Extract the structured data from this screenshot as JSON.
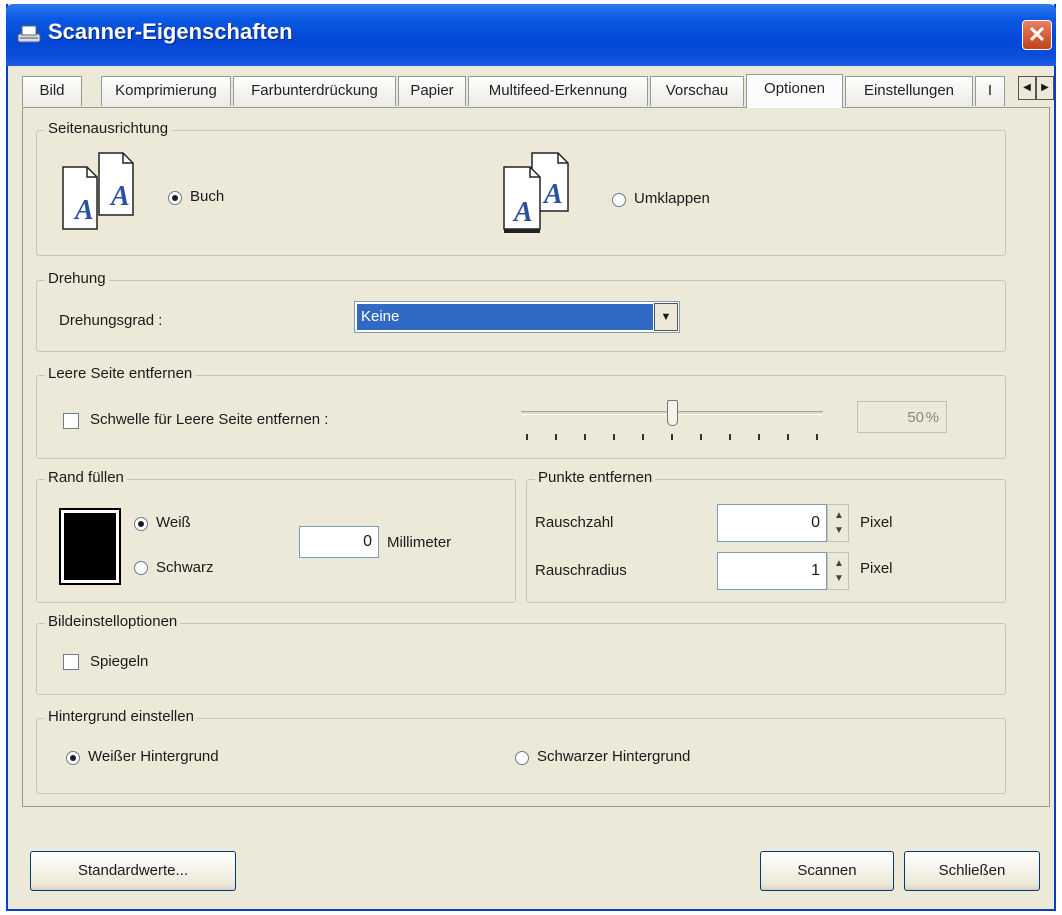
{
  "window": {
    "title": "Scanner-Eigenschaften",
    "close_label": "✕"
  },
  "tabs": [
    {
      "label": "Bild"
    },
    {
      "label": "Komprimierung"
    },
    {
      "label": "Farbunterdrückung"
    },
    {
      "label": "Papier"
    },
    {
      "label": "Multifeed-Erkennung"
    },
    {
      "label": "Vorschau"
    },
    {
      "label": "Optionen",
      "active": true
    },
    {
      "label": "Einstellungen"
    },
    {
      "label": "I"
    }
  ],
  "page_orientation": {
    "legend": "Seitenausrichtung",
    "book": {
      "label": "Buch",
      "checked": true
    },
    "flip": {
      "label": "Umklappen",
      "checked": false
    }
  },
  "rotation": {
    "legend": "Drehung",
    "degree_label": "Drehungsgrad :",
    "selected": "Keine"
  },
  "blank_page": {
    "legend": "Leere Seite entfernen",
    "threshold_label": "Schwelle für Leere Seite entfernen :",
    "threshold_checked": false,
    "slider_value": "50",
    "slider_unit": "%",
    "slider_level": 0.5
  },
  "edge_fill": {
    "legend": "Rand füllen",
    "white_label": "Weiß",
    "black_label": "Schwarz",
    "selected": "white",
    "value": "0",
    "unit": "Millimeter"
  },
  "noise_removal": {
    "legend": "Punkte entfernen",
    "count_label": "Rauschzahl",
    "count_value": "0",
    "radius_label": "Rauschradius",
    "radius_value": "1",
    "unit": "Pixel"
  },
  "image_options": {
    "legend": "Bildeinstelloptionen",
    "mirror_label": "Spiegeln",
    "mirror_checked": false
  },
  "background": {
    "legend": "Hintergrund einstellen",
    "white_label": "Weißer Hintergrund",
    "black_label": "Schwarzer Hintergrund",
    "selected": "white"
  },
  "buttons": {
    "defaults": "Standardwerte...",
    "scan": "Scannen",
    "close": "Schließen"
  },
  "colors": {
    "title_blue": "#0a58e2",
    "selection_blue": "#316ac5",
    "face": "#ece9d8"
  }
}
